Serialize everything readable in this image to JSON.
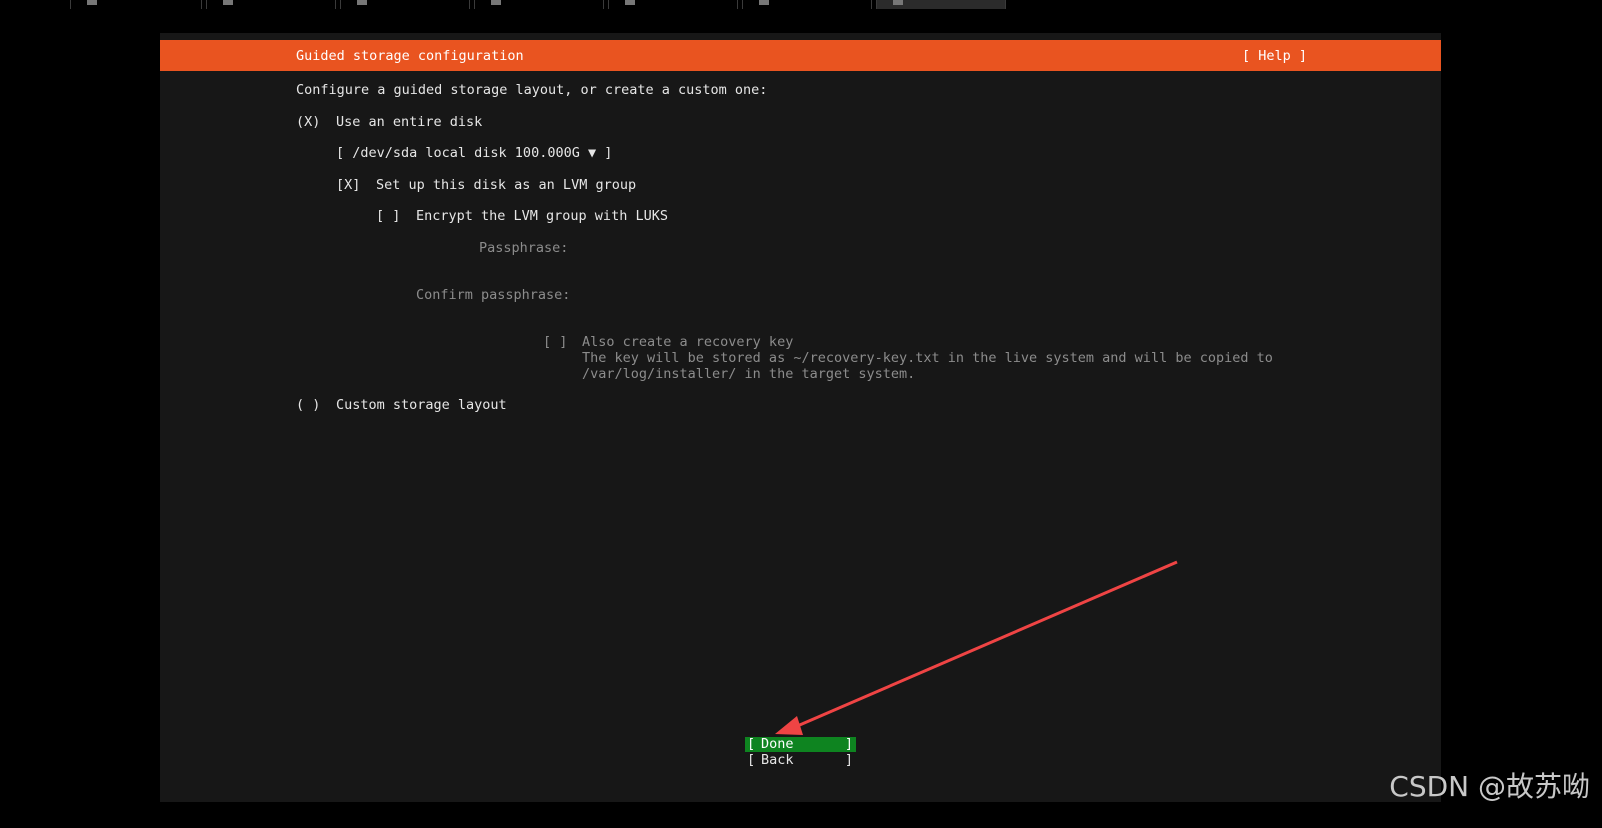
{
  "header": {
    "title": "Guided storage configuration",
    "help_label": "[ Help ]"
  },
  "intro": "Configure a guided storage layout, or create a custom one:",
  "options": {
    "entire_disk": {
      "marker": "(X)",
      "label": "Use an entire disk"
    },
    "disk_select": {
      "value": "[ /dev/sda local disk 100.000G ▼ ]"
    },
    "lvm": {
      "marker": "[X]",
      "label": "Set up this disk as an LVM group"
    },
    "encrypt": {
      "marker": "[ ]",
      "label": "Encrypt the LVM group with LUKS"
    },
    "passphrase_label": "Passphrase:",
    "confirm_label": "Confirm passphrase:",
    "recovery": {
      "marker": "[ ]",
      "label": "Also create a recovery key",
      "desc_line1": "The key will be stored as ~/recovery-key.txt in the live system and will be copied to",
      "desc_line2": "/var/log/installer/ in the target system."
    },
    "custom": {
      "marker": "( )",
      "label": "Custom storage layout"
    }
  },
  "buttons": {
    "done": {
      "open": "[",
      "label": "Done",
      "close": "]"
    },
    "back": {
      "open": "[",
      "label": "Back",
      "close": "]"
    }
  },
  "colors": {
    "header_bg": "#e95420",
    "focused_button_bg": "#0e8420",
    "terminal_bg": "#171717",
    "arrow": "#ef4444"
  },
  "watermark": "CSDN @故苏呦"
}
